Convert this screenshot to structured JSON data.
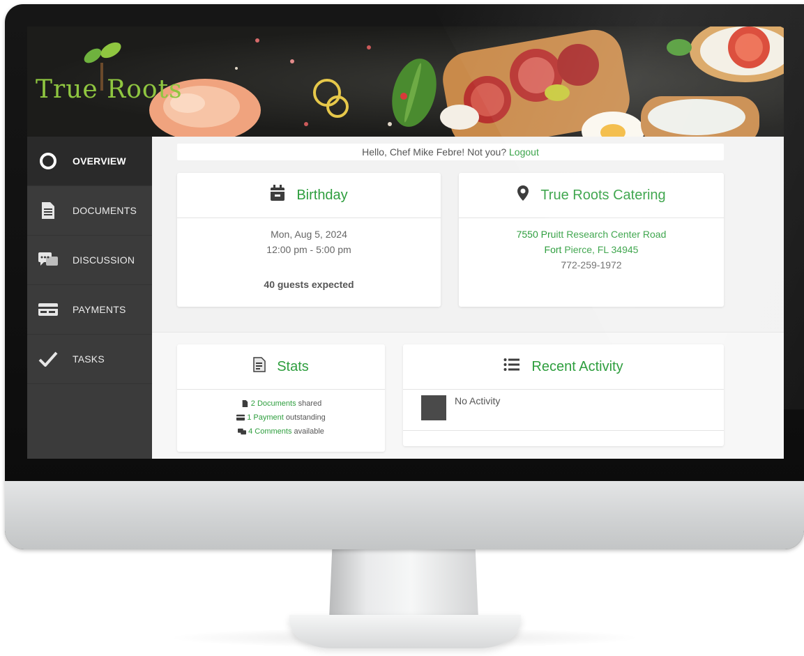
{
  "brand": {
    "logo_text": "True Roots",
    "accent_color": "#2e9e3e",
    "logo_color": "#8fc640"
  },
  "sidebar": {
    "items": [
      {
        "label": "OVERVIEW",
        "icon": "circle-ring-icon",
        "active": true
      },
      {
        "label": "DOCUMENTS",
        "icon": "document-icon",
        "active": false
      },
      {
        "label": "DISCUSSION",
        "icon": "chat-bubbles-icon",
        "active": false
      },
      {
        "label": "PAYMENTS",
        "icon": "credit-card-icon",
        "active": false
      },
      {
        "label": "TASKS",
        "icon": "checkmark-icon",
        "active": false
      }
    ]
  },
  "greeting": {
    "text": "Hello, Chef Mike Febre! Not you?",
    "logout_label": "Logout"
  },
  "event": {
    "title": "Birthday",
    "icon": "calendar-icon",
    "date": "Mon, Aug 5, 2024",
    "time": "12:00 pm - 5:00 pm",
    "guests": "40 guests expected"
  },
  "venue": {
    "title": "True Roots Catering",
    "icon": "map-pin-icon",
    "address_line1": "7550 Pruitt Research Center Road",
    "address_line2": "Fort Pierce, FL 34945",
    "phone": "772-259-1972"
  },
  "stats": {
    "title": "Stats",
    "icon": "document-list-icon",
    "documents": {
      "link": "2 Documents",
      "suffix": "shared"
    },
    "payments": {
      "link": "1 Payment",
      "suffix": "outstanding"
    },
    "comments": {
      "link": "4 Comments",
      "suffix": "available"
    }
  },
  "activity": {
    "title": "Recent Activity",
    "icon": "list-icon",
    "empty_text": "No Activity"
  }
}
